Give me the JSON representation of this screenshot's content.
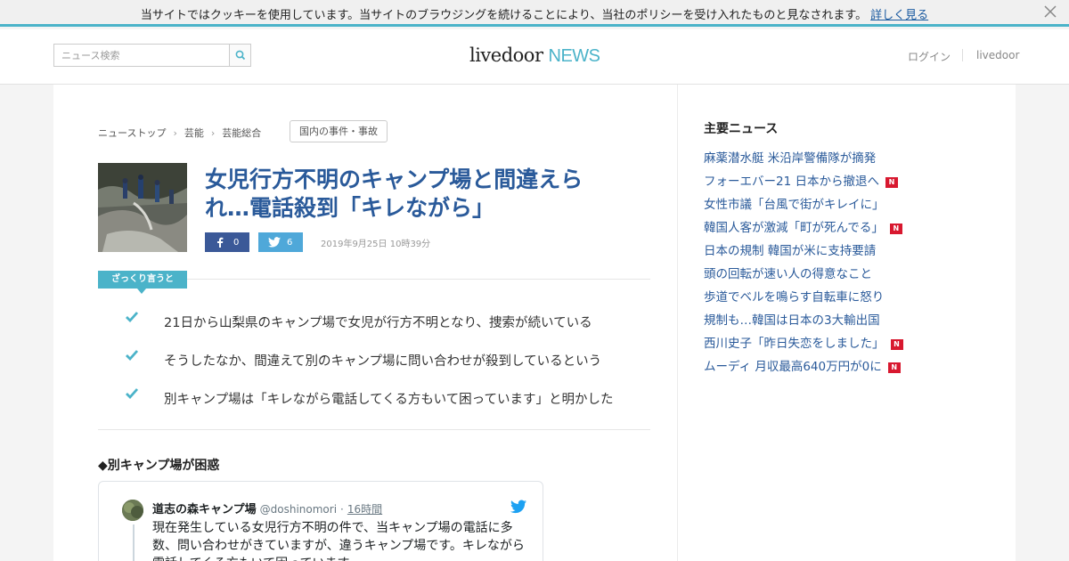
{
  "cookie": {
    "text": "当サイトではクッキーを使用しています。当サイトのブラウジングを続けることにより、当社のポリシーを受け入れたものと見なされます。",
    "link": "詳しく見る",
    "close_icon": "close-icon"
  },
  "header": {
    "search_placeholder": "ニュース検索",
    "search_icon": "search-icon",
    "logo_left": "livedoor",
    "logo_right": "NEWS",
    "login": "ログイン",
    "livedoor_link": "livedoor"
  },
  "breadcrumb": [
    "ニューストップ",
    "芸能",
    "芸能総合"
  ],
  "category_tag": "国内の事件・事故",
  "article": {
    "headline": "女児行方不明のキャンプ場と間違えられ…電話殺到「キレながら」",
    "facebook_count": "0",
    "twitter_count": "6",
    "date": "2019年9月25日 10時39分",
    "summary_label": "ざっくり言うと",
    "summary": [
      "21日から山梨県のキャンプ場で女児が行方不明となり、捜索が続いている",
      "そうしたなか、間違えて別のキャンプ場に問い合わせが殺到しているという",
      "別キャンプ場は「キレながら電話してくる方もいて困っています」と明かした"
    ],
    "section_heading": "◆別キャンプ場が困惑"
  },
  "tweet": {
    "name": "道志の森キャンプ場",
    "handle": "@doshinomori",
    "separator": "·",
    "time": "16時間",
    "text": "現在発生している女児行方不明の件で、当キャンプ場の電話に多数、問い合わせがきていますが、違うキャンプ場です。キレながら電話してくる方もいて困っています。"
  },
  "sidebar": {
    "title": "主要ニュース",
    "new_badge": "N",
    "items": [
      {
        "text": "麻薬潜水艇 米沿岸警備隊が摘発",
        "is_new": false
      },
      {
        "text": "フォーエバー21 日本から撤退へ",
        "is_new": true
      },
      {
        "text": "女性市議「台風で街がキレイに」",
        "is_new": false
      },
      {
        "text": "韓国人客が激減「町が死んでる」",
        "is_new": true
      },
      {
        "text": "日本の規制 韓国が米に支持要請",
        "is_new": false
      },
      {
        "text": "頭の回転が速い人の得意なこと",
        "is_new": false
      },
      {
        "text": "歩道でベルを鳴らす自転車に怒り",
        "is_new": false
      },
      {
        "text": "規制も…韓国は日本の3大輸出国",
        "is_new": false
      },
      {
        "text": "西川史子「昨日失恋をしました」",
        "is_new": true
      },
      {
        "text": "ムーディ 月収最高640万円が0に",
        "is_new": true
      }
    ]
  },
  "colors": {
    "accent": "#4bb3c9",
    "link": "#2a5a9a",
    "facebook": "#3b5998",
    "twitter": "#4fa8d9",
    "new_badge": "#d8182f"
  }
}
